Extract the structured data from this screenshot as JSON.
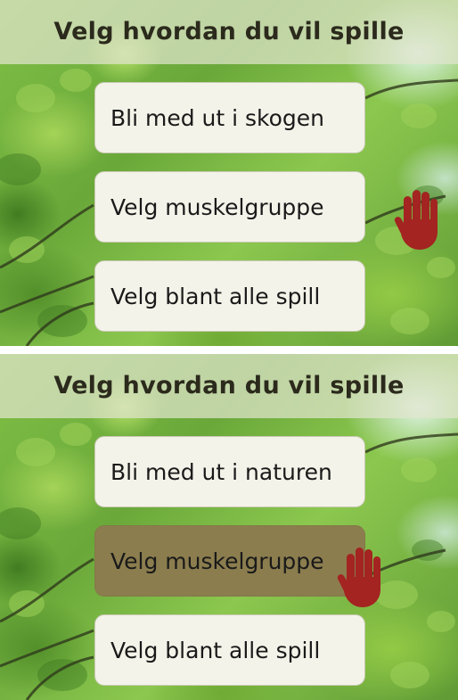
{
  "panels": [
    {
      "title": "Velg hvordan du vil spille",
      "options": [
        {
          "label": "Bli med ut i skogen",
          "selected": false
        },
        {
          "label": "Velg muskelgruppe",
          "selected": false
        },
        {
          "label": "Velg blant alle spill",
          "selected": false
        }
      ],
      "cursor_icon": "hand-icon"
    },
    {
      "title": "Velg hvordan du vil spille",
      "options": [
        {
          "label": "Bli med ut i naturen",
          "selected": false
        },
        {
          "label": "Velg muskelgruppe",
          "selected": true
        },
        {
          "label": "Velg blant alle spill",
          "selected": false
        }
      ],
      "cursor_icon": "hand-icon"
    }
  ],
  "colors": {
    "selected_button": "#8b7d4e",
    "button": "#f3f3e9",
    "hand": "#a32421"
  }
}
